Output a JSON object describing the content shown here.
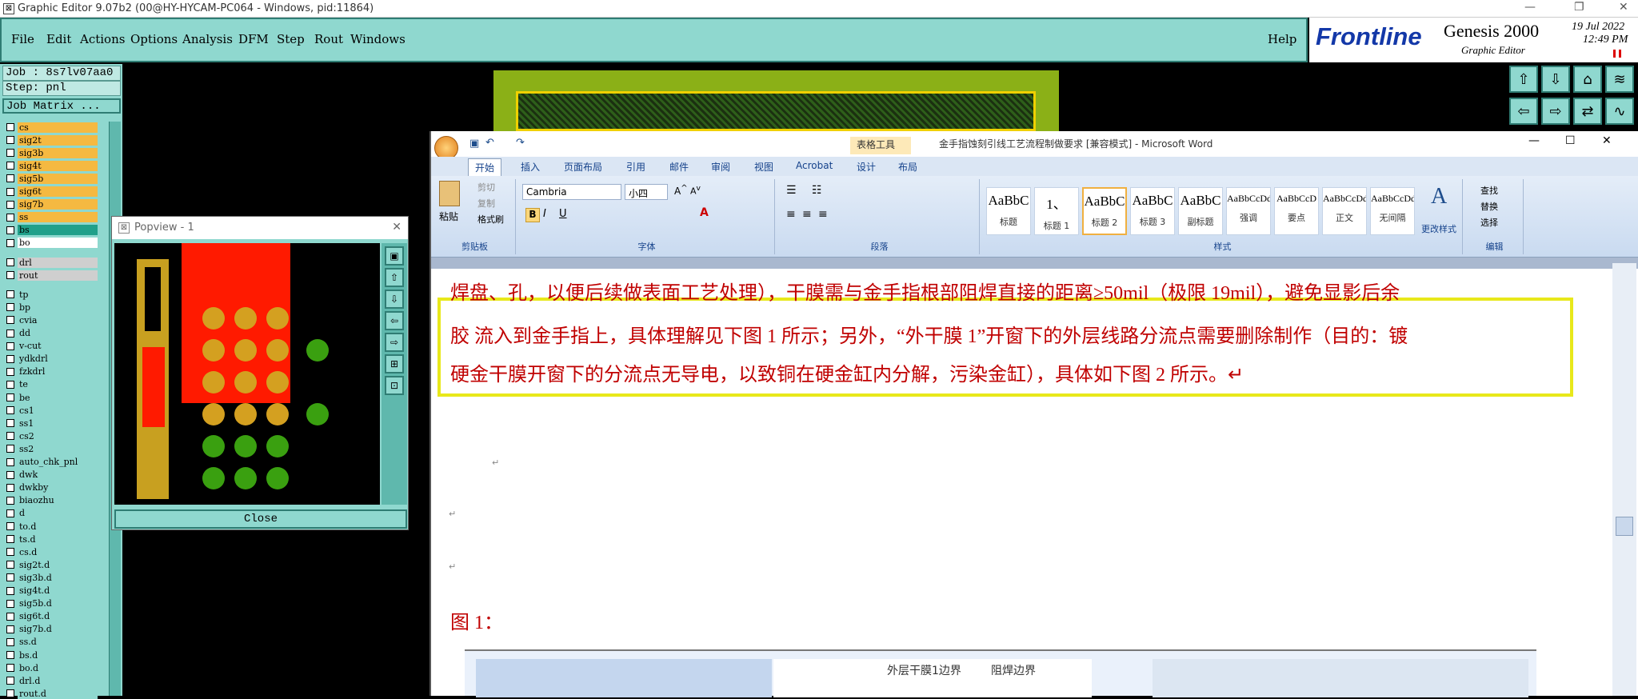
{
  "titlebar": {
    "text": "Graphic Editor 9.07b2 (00@HY-HYCAM-PC064 - Windows, pid:11864)"
  },
  "menu": {
    "items": [
      "File",
      "Edit",
      "Actions",
      "Options",
      "Analysis",
      "DFM",
      "Step",
      "Rout",
      "Windows"
    ],
    "help": "Help"
  },
  "brand": {
    "logo": "Frontline",
    "product": "Genesis 2000",
    "subtitle": "Graphic Editor",
    "date": "19 Jul 2022",
    "time": "12:49 PM"
  },
  "job": {
    "job": "Job : 8s7lv07aa0",
    "step": "Step: pnl",
    "matrix": "Job Matrix ..."
  },
  "layers": [
    {
      "name": "cs",
      "color": "#f5b941"
    },
    {
      "name": "sig2t",
      "color": "#f5b941"
    },
    {
      "name": "sig3b",
      "color": "#f5b941"
    },
    {
      "name": "sig4t",
      "color": "#f5b941"
    },
    {
      "name": "sig5b",
      "color": "#f5b941"
    },
    {
      "name": "sig6t",
      "color": "#f5b941"
    },
    {
      "name": "sig7b",
      "color": "#f5b941"
    },
    {
      "name": "ss",
      "color": "#f5b941"
    },
    {
      "name": "bs",
      "color": "#21a08a"
    },
    {
      "name": "bo",
      "color": "#ffffff"
    },
    {
      "name": "drl",
      "color": "#cfcfcf"
    },
    {
      "name": "rout",
      "color": "#cfcfcf"
    },
    {
      "name": "tp",
      "color": "#8fd8cf"
    },
    {
      "name": "bp",
      "color": "#8fd8cf"
    },
    {
      "name": "cvia",
      "color": "#8fd8cf"
    },
    {
      "name": "dd",
      "color": "#8fd8cf"
    },
    {
      "name": "v-cut",
      "color": "#8fd8cf"
    },
    {
      "name": "ydkdrl",
      "color": "#8fd8cf"
    },
    {
      "name": "fzkdrl",
      "color": "#8fd8cf"
    },
    {
      "name": "te",
      "color": "#8fd8cf"
    },
    {
      "name": "be",
      "color": "#8fd8cf"
    },
    {
      "name": "cs1",
      "color": "#8fd8cf"
    },
    {
      "name": "ss1",
      "color": "#8fd8cf"
    },
    {
      "name": "cs2",
      "color": "#8fd8cf"
    },
    {
      "name": "ss2",
      "color": "#8fd8cf"
    },
    {
      "name": "auto_chk_pnl",
      "color": "#8fd8cf"
    },
    {
      "name": "dwk",
      "color": "#8fd8cf"
    },
    {
      "name": "dwkby",
      "color": "#8fd8cf"
    },
    {
      "name": "biaozhu",
      "color": "#8fd8cf"
    },
    {
      "name": "d",
      "color": "#8fd8cf"
    },
    {
      "name": "to.d",
      "color": "#8fd8cf"
    },
    {
      "name": "ts.d",
      "color": "#8fd8cf"
    },
    {
      "name": "cs.d",
      "color": "#8fd8cf"
    },
    {
      "name": "sig2t.d",
      "color": "#8fd8cf"
    },
    {
      "name": "sig3b.d",
      "color": "#8fd8cf"
    },
    {
      "name": "sig4t.d",
      "color": "#8fd8cf"
    },
    {
      "name": "sig5b.d",
      "color": "#8fd8cf"
    },
    {
      "name": "sig6t.d",
      "color": "#8fd8cf"
    },
    {
      "name": "sig7b.d",
      "color": "#8fd8cf"
    },
    {
      "name": "ss.d",
      "color": "#8fd8cf"
    },
    {
      "name": "bs.d",
      "color": "#8fd8cf"
    },
    {
      "name": "bo.d",
      "color": "#8fd8cf"
    },
    {
      "name": "drl.d",
      "color": "#8fd8cf"
    },
    {
      "name": "rout.d",
      "color": "#8fd8cf"
    }
  ],
  "popview": {
    "title": "Popview - 1",
    "close": "Close"
  },
  "word": {
    "title": "金手指蚀刻引线工艺流程制做要求 [兼容模式] - Microsoft Word",
    "context_tab": "表格工具",
    "tabs": [
      "开始",
      "插入",
      "页面布局",
      "引用",
      "邮件",
      "审阅",
      "视图",
      "Acrobat",
      "设计",
      "布局"
    ],
    "clipboard": {
      "paste": "粘贴",
      "cut": "剪切",
      "copy": "复制",
      "format": "格式刷",
      "label": "剪贴板"
    },
    "font": {
      "name": "Cambria",
      "size": "小四",
      "label": "字体"
    },
    "paragraph_label": "段落",
    "styles": [
      {
        "preview": "AaBbC",
        "name": "标题"
      },
      {
        "preview": "1、",
        "name": "标题 1"
      },
      {
        "preview": "AaBbC",
        "name": "标题 2"
      },
      {
        "preview": "AaBbC",
        "name": "标题 3"
      },
      {
        "preview": "AaBbC",
        "name": "副标题"
      },
      {
        "preview": "AaBbCcDd",
        "name": "强调"
      },
      {
        "preview": "AaBbCcD",
        "name": "要点"
      },
      {
        "preview": "AaBbCcDd",
        "name": "正文"
      },
      {
        "preview": "AaBbCcDd",
        "name": "无间隔"
      }
    ],
    "styles_label": "样式",
    "change_styles": "更改样式",
    "edit": {
      "find": "查找",
      "replace": "替换",
      "select": "选择",
      "label": "编辑"
    },
    "doc_lines": [
      "焊盘、孔，以便后续做表面工艺处理），干膜需与金手指根部阻焊直接的距离≥50mil（极限 19mil），避免显影后余",
      "胶  流入到金手指上，具体理解见下图 1 所示；另外，“外干膜 1”开窗下的外层线路分流点需要删除制作（目的：镀",
      "硬金干膜开窗下的分流点无导电，以致铜在硬金缸内分解，污染金缸），具体如下图 2 所示。↵"
    ],
    "fig_label": "图 1：",
    "thumb": {
      "label1": "外层干膜1边界",
      "label2": "阻焊边界"
    }
  }
}
